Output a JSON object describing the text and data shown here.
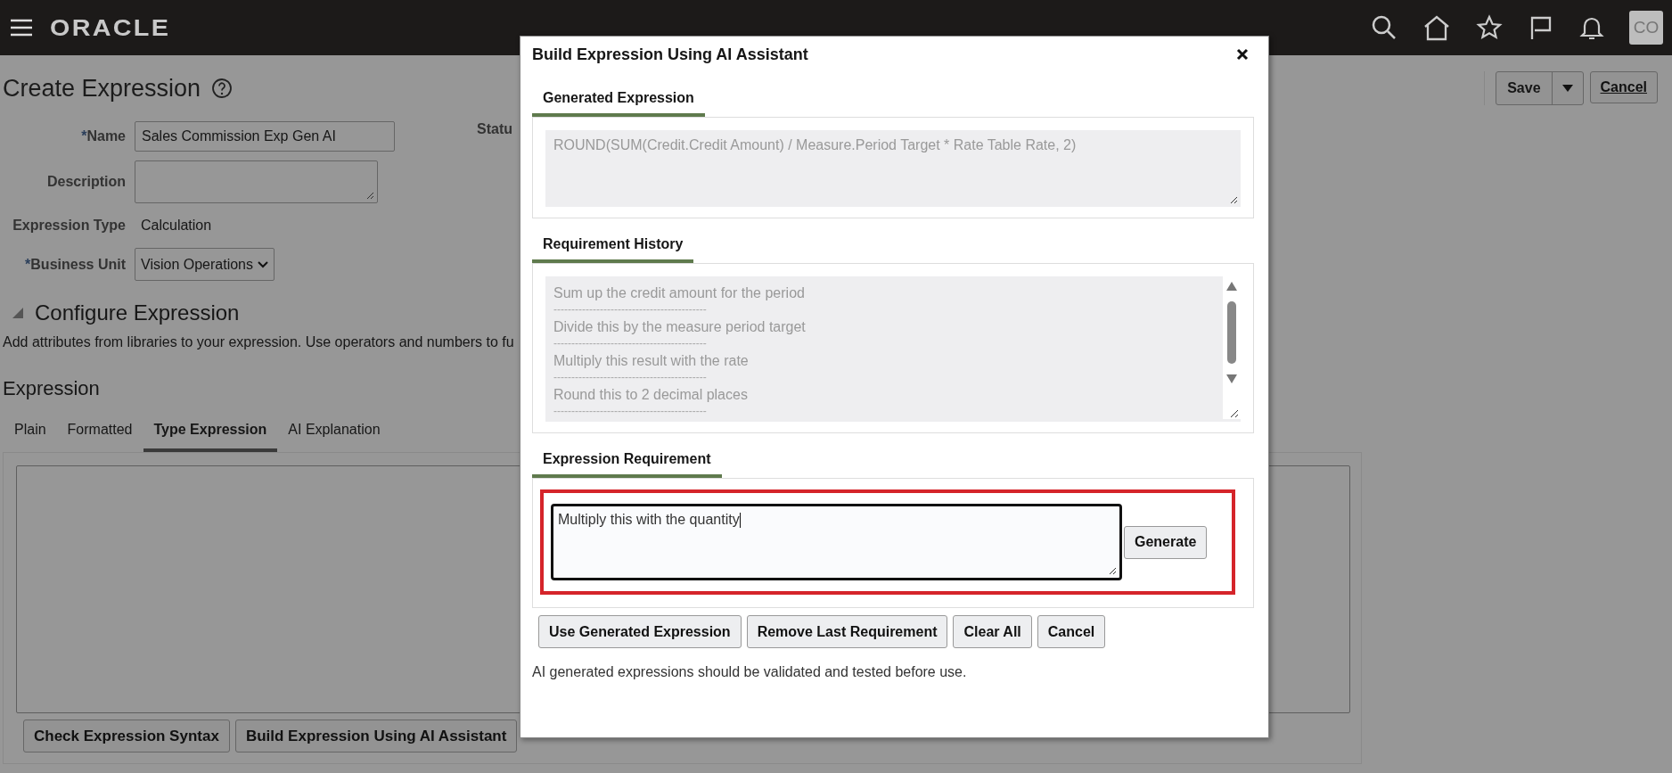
{
  "top_bar": {
    "logo": "ORACLE",
    "avatar": "CO"
  },
  "page": {
    "title": "Create Expression",
    "actions": {
      "save": "Save",
      "cancel": "Cancel"
    },
    "fields": [
      {
        "kind": "input",
        "required_mark": "*",
        "label": "Name",
        "value": "Sales Commission Exp Gen AI"
      },
      {
        "kind": "textarea",
        "label": "Description"
      },
      {
        "kind": "text",
        "label": "Expression Type",
        "value": "Calculation"
      },
      {
        "kind": "select",
        "required_mark": "*",
        "label": "Business Unit",
        "value": "Vision Operations"
      }
    ],
    "status_label": "Statu",
    "section": {
      "title": "Configure Expression",
      "expanded": true,
      "help": "Add attributes from libraries to your expression. Use operators and numbers to fu"
    },
    "expression": {
      "title": "Expression",
      "tabs": [
        {
          "label": "Plain",
          "selected": false
        },
        {
          "label": "Formatted",
          "selected": false
        },
        {
          "label": "Type Expression",
          "selected": true
        },
        {
          "label": "AI Explanation",
          "selected": false
        }
      ],
      "buttons": [
        "Check Expression Syntax",
        "Build Expression Using AI Assistant"
      ]
    }
  },
  "dialog": {
    "title": "Build Expression Using AI Assistant",
    "generated": {
      "title": "Generated Expression",
      "value": "ROUND(SUM(Credit.Credit Amount) / Measure.Period Target * Rate Table Rate, 2)"
    },
    "history": {
      "title": "Requirement History",
      "entries": [
        {
          "text": "Sum up the credit amount for the period",
          "divider": "-------------------------------------------"
        },
        {
          "text": "Divide this by the measure period target",
          "divider": "-------------------------------------------"
        },
        {
          "text": "Multiply this result with the rate",
          "divider": "-------------------------------------------"
        },
        {
          "text": "Round this to 2 decimal places",
          "divider": "-------------------------------------------"
        }
      ]
    },
    "requirement": {
      "title": "Expression Requirement",
      "value": "Multiply this with the quantity",
      "highlighted": true,
      "button": "Generate"
    },
    "buttons": [
      "Use Generated Expression",
      "Remove Last Requirement",
      "Clear All",
      "Cancel"
    ],
    "note": "AI generated expressions should be validated and tested before use."
  }
}
